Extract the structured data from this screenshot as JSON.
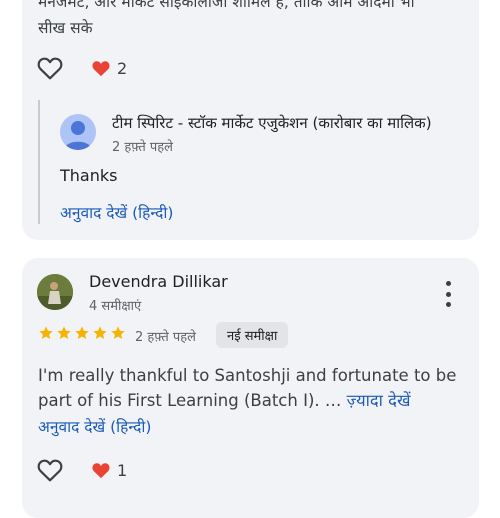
{
  "review1": {
    "truncated_line": "मैनेजमेंट, और मार्केट साइकोलॉजी शामिल है, ताकि आम आदमी भी",
    "text_line2": "सीख सके",
    "like_count": "2",
    "reply": {
      "owner_name": "टीम स्पिरिट - स्टॉक मार्केट एजुकेशन (कारोबार का मालिक)",
      "time": "2 हफ़्ते पहले",
      "text": "Thanks",
      "translate_label": "अनुवाद देखें (हिन्दी)"
    }
  },
  "review2": {
    "author": "Devendra Dillikar",
    "reviews_count": "4 समीक्षाएं",
    "rating": 5,
    "time": "2 हफ़्ते पहले",
    "badge": "नई समीक्षा",
    "body": "I'm really thankful to Santoshji and fortunate to be part of his First Learning (Batch I). …",
    "more_label": "ज़्यादा देखें",
    "translate_label": "अनुवाद देखें (हिन्दी)",
    "like_count": "1"
  },
  "colors": {
    "card_bg": "#f2f3f6",
    "link": "#1a5bb8",
    "star": "#f4b400",
    "heart": "#ea4335"
  }
}
